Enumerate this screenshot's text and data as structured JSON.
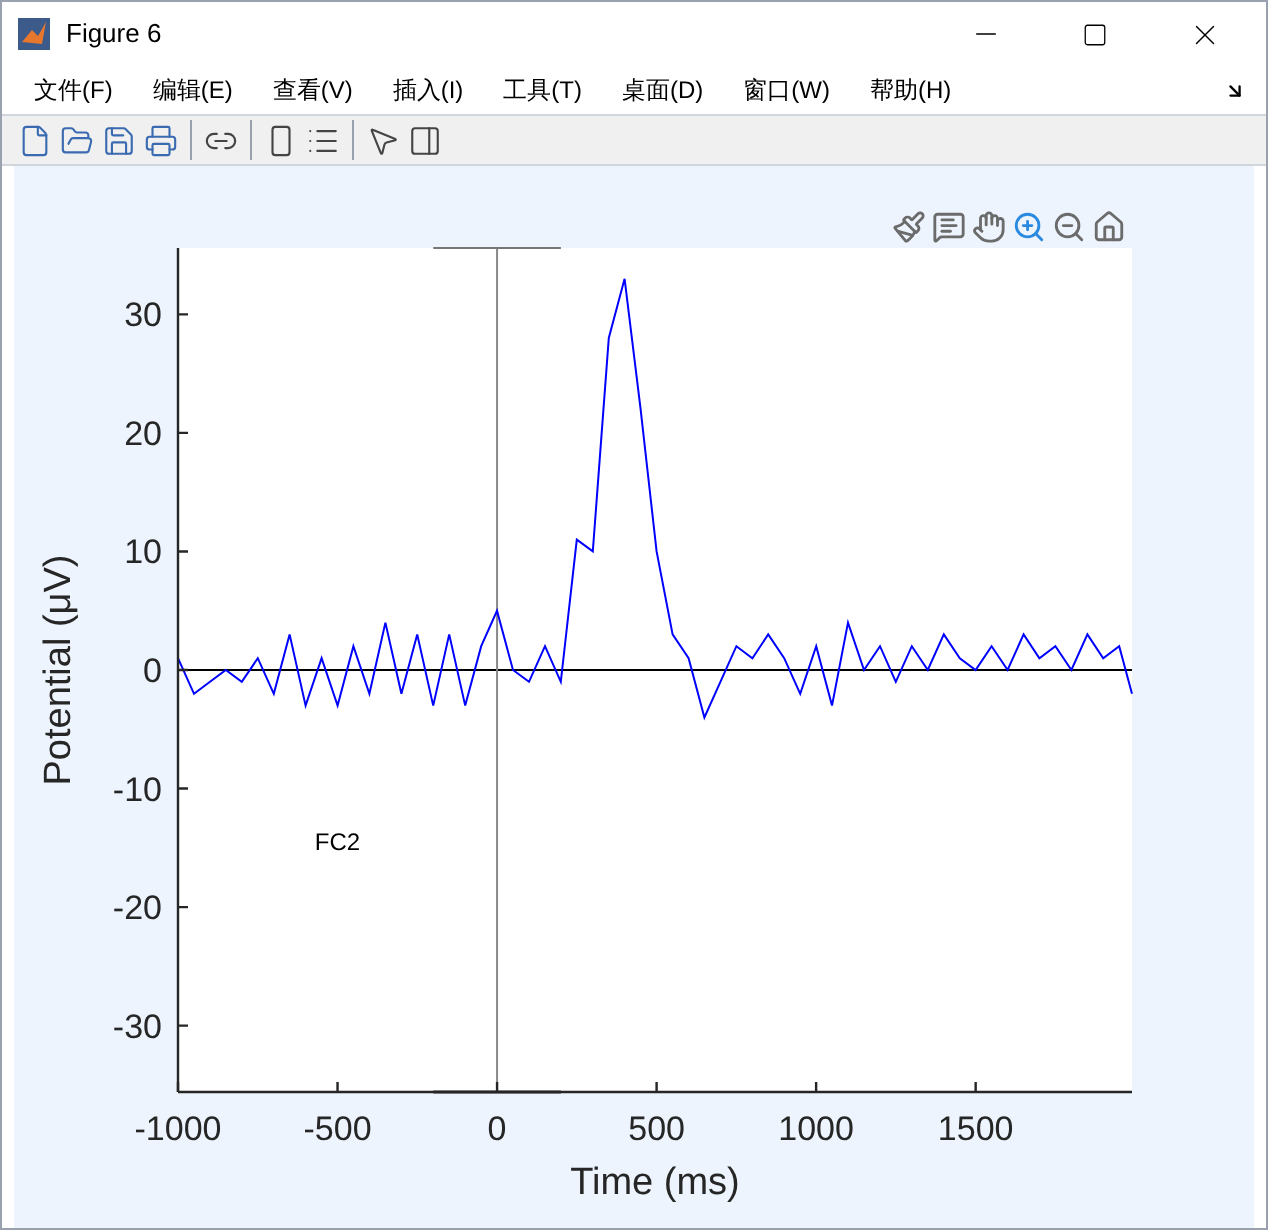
{
  "window": {
    "title": "Figure 6"
  },
  "menu": [
    "文件(F)",
    "编辑(E)",
    "查看(V)",
    "插入(I)",
    "工具(T)",
    "桌面(D)",
    "窗口(W)",
    "帮助(H)"
  ],
  "chart_data": {
    "type": "line",
    "xlabel": "Time (ms)",
    "ylabel": "Potential (μV)",
    "xlim": [
      -1000,
      1990
    ],
    "ylim": [
      -35.6,
      35.6
    ],
    "xticks": [
      -1000,
      -500,
      0,
      500,
      1000,
      1500
    ],
    "yticks": [
      -30,
      -20,
      -10,
      0,
      10,
      20,
      30
    ],
    "x": [
      -1000,
      -950,
      -900,
      -850,
      -800,
      -750,
      -700,
      -650,
      -600,
      -550,
      -500,
      -450,
      -400,
      -350,
      -300,
      -250,
      -200,
      -150,
      -100,
      -50,
      0,
      50,
      100,
      150,
      200,
      250,
      300,
      350,
      400,
      450,
      500,
      550,
      600,
      650,
      700,
      750,
      800,
      850,
      900,
      950,
      1000,
      1050,
      1100,
      1150,
      1200,
      1250,
      1300,
      1350,
      1400,
      1450,
      1500,
      1550,
      1600,
      1650,
      1700,
      1750,
      1800,
      1850,
      1900,
      1950,
      1990
    ],
    "series": [
      {
        "name": "FC2",
        "color": "#0000ff",
        "values": [
          1,
          -2,
          -1,
          0,
          -1,
          1,
          -2,
          3,
          -3,
          1,
          -3,
          2,
          -2,
          4,
          -2,
          3,
          -3,
          3,
          -3,
          2,
          5,
          0,
          -1,
          2,
          -1,
          11,
          10,
          28,
          33,
          22,
          10,
          3,
          1,
          -4,
          -1,
          2,
          1,
          3,
          1,
          -2,
          2,
          -3,
          4,
          0,
          2,
          -1,
          2,
          0,
          3,
          1,
          0,
          2,
          0,
          3,
          1,
          2,
          0,
          3,
          1,
          2,
          -2
        ]
      }
    ]
  }
}
